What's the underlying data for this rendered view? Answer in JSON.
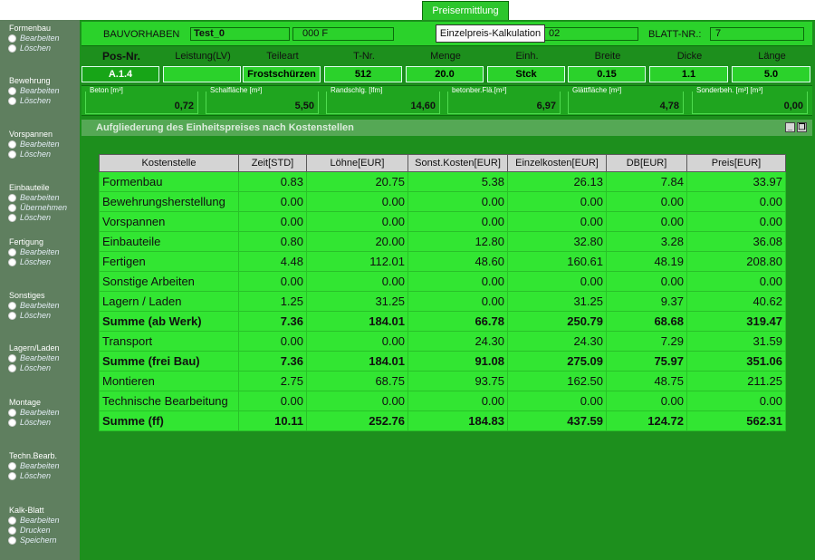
{
  "top_tab": "Preisermittlung",
  "sidebar": [
    {
      "title": "Formenbau",
      "items": [
        "Bearbeiten",
        "Löschen"
      ]
    },
    {
      "title": "Bewehrung",
      "items": [
        "Bearbeiten",
        "Löschen"
      ]
    },
    {
      "title": "Vorspannen",
      "items": [
        "Bearbeiten",
        "Löschen"
      ]
    },
    {
      "title": "Einbauteile",
      "items": [
        "Bearbeiten",
        "Übernehmen",
        "Löschen"
      ]
    },
    {
      "title": "Fertigung",
      "items": [
        "Bearbeiten",
        "Löschen"
      ]
    },
    {
      "title": "Sonstiges",
      "items": [
        "Bearbeiten",
        "Löschen"
      ]
    },
    {
      "title": "Lagern/Laden",
      "items": [
        "Bearbeiten",
        "Löschen"
      ]
    },
    {
      "title": "Montage",
      "items": [
        "Bearbeiten",
        "Löschen"
      ]
    },
    {
      "title": "Techn.Bearb.",
      "items": [
        "Bearbeiten",
        "Löschen"
      ]
    },
    {
      "title": "Kalk-Blatt",
      "items": [
        "Bearbeiten",
        "Drucken",
        "Speichern"
      ]
    }
  ],
  "header": {
    "bauvorhaben_label": "BAUVORHABEN",
    "bauvorhaben_value": "Test_0",
    "code_value": "000 F",
    "tooltip": "Einzelpreis-Kalkulation",
    "hidden_value": "02",
    "blatt_label": "BLATT-NR.:",
    "blatt_value": "7"
  },
  "position": {
    "headers": [
      "Pos-Nr.",
      "Leistung(LV)",
      "Teileart",
      "T-Nr.",
      "Menge",
      "Einh.",
      "Breite",
      "Dicke",
      "Länge"
    ],
    "values": [
      "A.1.4",
      "",
      "Frostschürzen",
      "512",
      "20.0",
      "Stck",
      "0.15",
      "1.1",
      "5.0"
    ]
  },
  "measures": [
    {
      "label": "Beton [m³]",
      "value": "0,72"
    },
    {
      "label": "Schalfläche [m²]",
      "value": "5,50"
    },
    {
      "label": "Randschlg. [lfm]",
      "value": "14,60"
    },
    {
      "label": "betonber.Flä.[m²]",
      "value": "6,97"
    },
    {
      "label": "Glättfläche [m²]",
      "value": "4,78"
    },
    {
      "label": "Sonderbeh. [m²] [m³]",
      "value": "0,00"
    }
  ],
  "panel": {
    "title": "Aufgliederung des Einheitspreises nach Kostenstellen"
  },
  "table": {
    "columns": [
      "Kostenstelle",
      "Zeit[STD]",
      "Löhne[EUR]",
      "Sonst.Kosten[EUR]",
      "Einzelkosten[EUR]",
      "DB[EUR]",
      "Preis[EUR]"
    ],
    "rows": [
      {
        "cells": [
          "Formenbau",
          "0.83",
          "20.75",
          "5.38",
          "26.13",
          "7.84",
          "33.97"
        ],
        "bold": false
      },
      {
        "cells": [
          "Bewehrungsherstellung",
          "0.00",
          "0.00",
          "0.00",
          "0.00",
          "0.00",
          "0.00"
        ],
        "bold": false
      },
      {
        "cells": [
          "Vorspannen",
          "0.00",
          "0.00",
          "0.00",
          "0.00",
          "0.00",
          "0.00"
        ],
        "bold": false
      },
      {
        "cells": [
          "Einbauteile",
          "0.80",
          "20.00",
          "12.80",
          "32.80",
          "3.28",
          "36.08"
        ],
        "bold": false
      },
      {
        "cells": [
          "Fertigen",
          "4.48",
          "112.01",
          "48.60",
          "160.61",
          "48.19",
          "208.80"
        ],
        "bold": false
      },
      {
        "cells": [
          "Sonstige Arbeiten",
          "0.00",
          "0.00",
          "0.00",
          "0.00",
          "0.00",
          "0.00"
        ],
        "bold": false
      },
      {
        "cells": [
          "Lagern / Laden",
          "1.25",
          "31.25",
          "0.00",
          "31.25",
          "9.37",
          "40.62"
        ],
        "bold": false
      },
      {
        "cells": [
          "Summe (ab Werk)",
          "7.36",
          "184.01",
          "66.78",
          "250.79",
          "68.68",
          "319.47"
        ],
        "bold": true
      },
      {
        "cells": [
          "Transport",
          "0.00",
          "0.00",
          "24.30",
          "24.30",
          "7.29",
          "31.59"
        ],
        "bold": false
      },
      {
        "cells": [
          "Summe (frei Bau)",
          "7.36",
          "184.01",
          "91.08",
          "275.09",
          "75.97",
          "351.06"
        ],
        "bold": true
      },
      {
        "cells": [
          "Montieren",
          "2.75",
          "68.75",
          "93.75",
          "162.50",
          "48.75",
          "211.25"
        ],
        "bold": false
      },
      {
        "cells": [
          "Technische Bearbeitung",
          "0.00",
          "0.00",
          "0.00",
          "0.00",
          "0.00",
          "0.00"
        ],
        "bold": false
      },
      {
        "cells": [
          "Summe (ff)",
          "10.11",
          "252.76",
          "184.83",
          "437.59",
          "124.72",
          "562.31"
        ],
        "bold": true
      }
    ]
  }
}
